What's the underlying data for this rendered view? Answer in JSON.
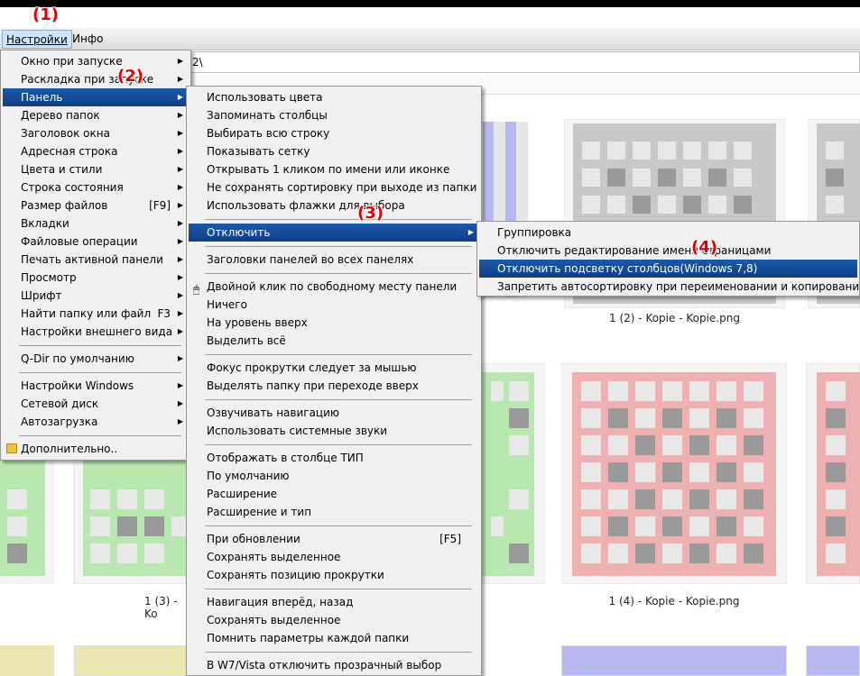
{
  "menubar": {
    "settings": "Настройки",
    "info": "Инфо"
  },
  "address": {
    "value": "2\\"
  },
  "annotations": [
    "(1)",
    "(2)",
    "(3)",
    "(4)"
  ],
  "captions": [
    "1 (2) - Kopie - Kopie.png",
    "1 (3) - Ko",
    "1 (4) - Kopie - Kopie.png"
  ],
  "menu1": [
    {
      "label": "Окно при запуске",
      "arrow": "▶"
    },
    {
      "label": "Раскладка при запуске",
      "arrow": "▶"
    },
    {
      "label": "Панель",
      "arrow": "▶"
    },
    {
      "label": "Дерево папок",
      "arrow": "▶"
    },
    {
      "label": "Заголовок окна",
      "arrow": "▶"
    },
    {
      "label": "Адресная строка",
      "arrow": "▶"
    },
    {
      "label": "Цвета и стили",
      "arrow": "▶"
    },
    {
      "label": "Строка состояния",
      "arrow": "▶"
    },
    {
      "label": "Размер файлов",
      "shortcut": "[F9]",
      "arrow": "▶"
    },
    {
      "label": "Вкладки",
      "arrow": "▶"
    },
    {
      "label": "Файловые операции",
      "arrow": "▶"
    },
    {
      "label": "Печать активной панели",
      "arrow": "▶"
    },
    {
      "label": "Просмотр",
      "arrow": "▶"
    },
    {
      "label": "Шрифт",
      "arrow": "▶"
    },
    {
      "label": "Найти папку или файл",
      "shortcut": "F3",
      "arrow": "▶"
    },
    {
      "label": "Настройки внешнего вида",
      "arrow": "▶"
    },
    {
      "label": "Q-Dir по умолчанию",
      "arrow": "▶"
    },
    {
      "label": "Настройки Windows",
      "arrow": "▶"
    },
    {
      "label": "Сетевой диск",
      "arrow": "▶"
    },
    {
      "label": "Автозагрузка",
      "arrow": "▶"
    },
    {
      "label": "Дополнительно.."
    }
  ],
  "menu2": [
    {
      "label": "Использовать цвета"
    },
    {
      "label": "Запоминать столбцы"
    },
    {
      "label": "Выбирать всю строку"
    },
    {
      "label": "Показывать сетку"
    },
    {
      "label": "Открывать 1 кликом по имени или иконке"
    },
    {
      "label": "Не сохранять сортировку при выходе из папки"
    },
    {
      "label": "Использовать флажки для выбора"
    },
    {
      "label": "Отключить",
      "arrow": "▶"
    },
    {
      "label": "Заголовки панелей во всех панелях"
    },
    {
      "label": "Двойной клик по свободному месту панели"
    },
    {
      "label": "Ничего"
    },
    {
      "label": "На уровень вверх"
    },
    {
      "label": "Выделить всё"
    },
    {
      "label": "Фокус прокрутки следует за мышью"
    },
    {
      "label": "Выделять папку при переходе вверх"
    },
    {
      "label": "Озвучивать навигацию"
    },
    {
      "label": "Использовать системные звуки"
    },
    {
      "label": "Отображать в столбце ТИП"
    },
    {
      "label": "По умолчанию"
    },
    {
      "label": "Расширение"
    },
    {
      "label": "Расширение и тип"
    },
    {
      "label": "При обновлении",
      "shortcut": "[F5]"
    },
    {
      "label": "Сохранять выделенное"
    },
    {
      "label": "Сохранять позицию прокрутки"
    },
    {
      "label": "Навигация вперёд, назад"
    },
    {
      "label": "Сохранять выделенное"
    },
    {
      "label": "Помнить параметры каждой папки"
    },
    {
      "label": "В W7/Vista отключить прозрачный выбор"
    }
  ],
  "menu3": [
    {
      "label": "Группировка"
    },
    {
      "label": "Отключить редактирование имени страницами"
    },
    {
      "label": "Отключить подсветку столбцов(Windows 7,8)"
    },
    {
      "label": "Запретить автосортировку при переименовании и копировании"
    }
  ],
  "icons": {
    "folder": "folder-icon",
    "mouse": "mouse-icon",
    "submenu": "submenu-arrow-icon"
  },
  "colors": {
    "highlight": "#1b5aa8",
    "annotation": "#e00000",
    "thumb_gray": "#c8c8c8",
    "thumb_blue": "#b8b8f0",
    "thumb_green": "#b8e8b0",
    "thumb_red": "#eeb0b0",
    "thumb_yellow": "#ece6b0"
  }
}
